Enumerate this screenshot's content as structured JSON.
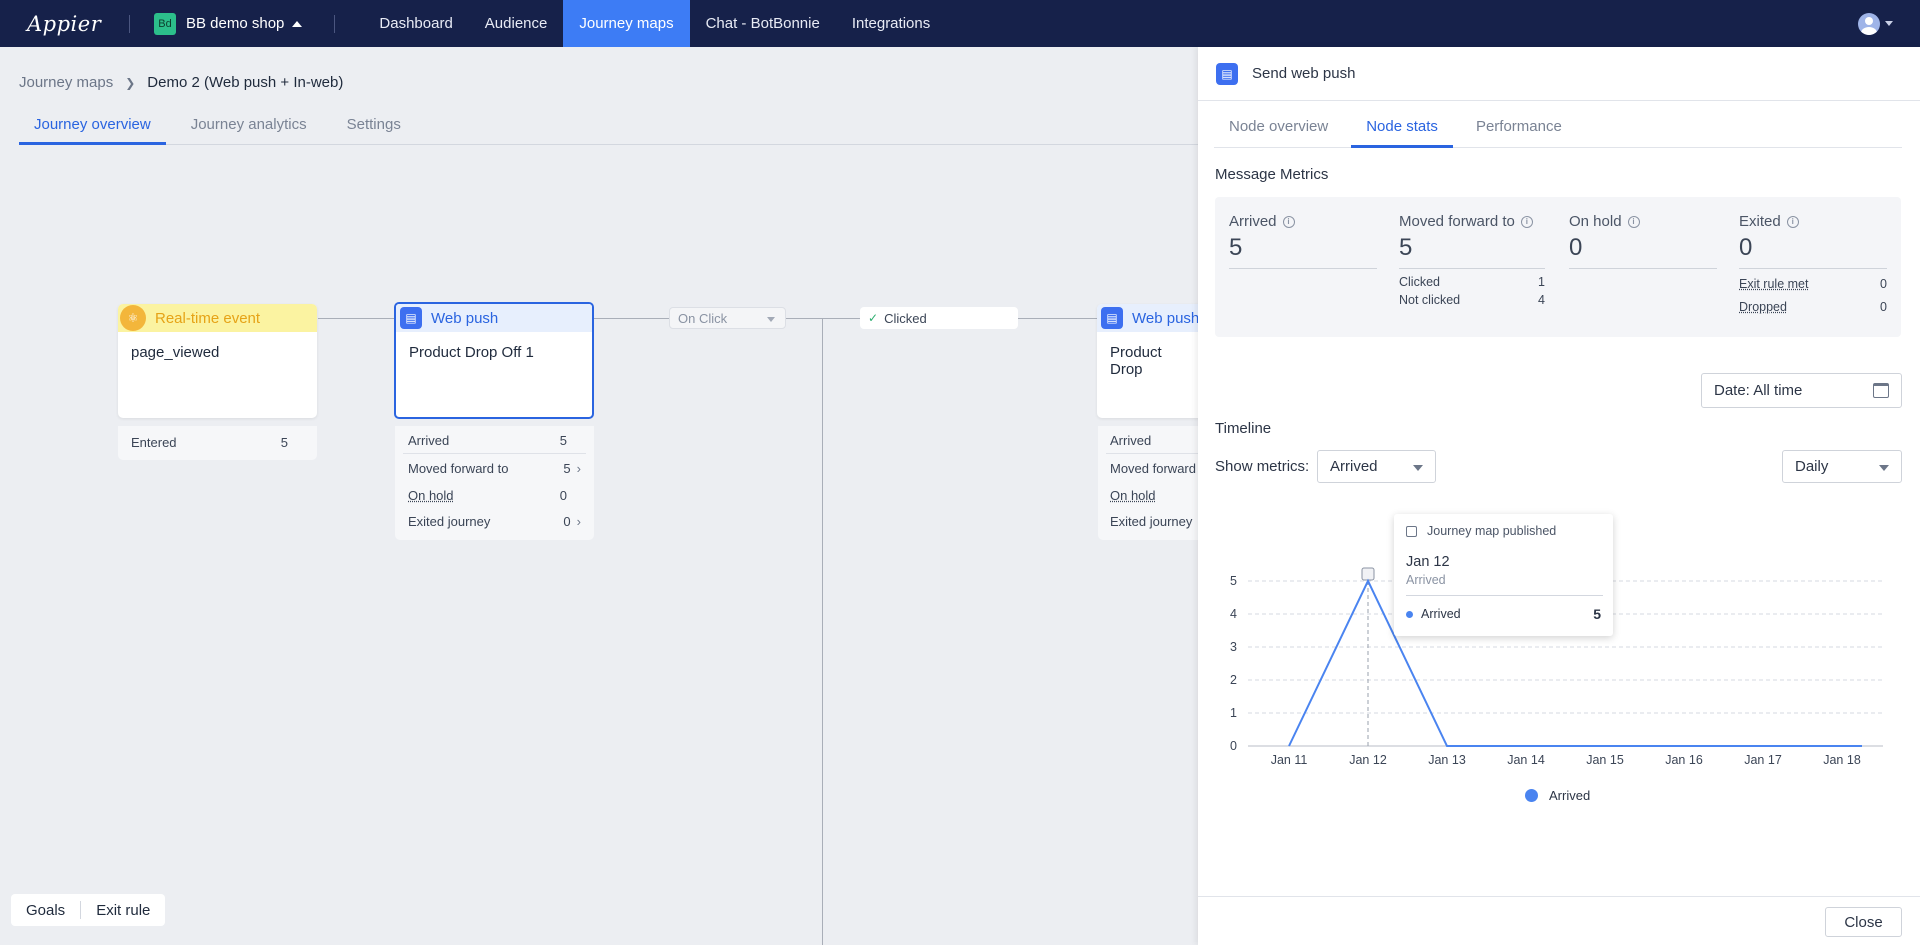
{
  "app": {
    "logo": "Appier"
  },
  "shop": {
    "badge": "Bd",
    "name": "BB demo shop"
  },
  "nav": {
    "items": [
      "Dashboard",
      "Audience",
      "Journey maps",
      "Chat - BotBonnie",
      "Integrations"
    ],
    "active_index": 2
  },
  "breadcrumb": {
    "parent": "Journey maps",
    "current": "Demo 2 (Web push + In-web)"
  },
  "subtabs": [
    "Journey overview",
    "Journey analytics",
    "Settings"
  ],
  "canvas": {
    "event_node": {
      "type": "Real-time event",
      "event": "page_viewed",
      "entered_label": "Entered",
      "entered_value": "5"
    },
    "push_node": {
      "type": "Web push",
      "name": "Product Drop Off 1",
      "stats": [
        {
          "label": "Arrived",
          "value": "5"
        },
        {
          "label": "Moved forward to",
          "value": "5"
        },
        {
          "label": "On hold",
          "value": "0"
        },
        {
          "label": "Exited journey",
          "value": "0"
        }
      ]
    },
    "on_click_label": "On Click",
    "clicked_label": "Clicked",
    "push_node_2": {
      "type": "Web push",
      "name": "Product Drop",
      "stats": [
        "Arrived",
        "Moved forward",
        "On hold",
        "Exited journey"
      ]
    }
  },
  "bottom_bar": {
    "goals": "Goals",
    "exit_rule": "Exit rule"
  },
  "panel": {
    "title": "Send web push",
    "tabs": [
      "Node overview",
      "Node stats",
      "Performance"
    ],
    "active_tab": 1,
    "metrics_title": "Message Metrics",
    "metrics": {
      "arrived": {
        "label": "Arrived",
        "value": "5"
      },
      "moved": {
        "label": "Moved forward to",
        "value": "5",
        "clicked_label": "Clicked",
        "clicked": "1",
        "not_clicked_label": "Not clicked",
        "not_clicked": "4"
      },
      "on_hold": {
        "label": "On hold",
        "value": "0"
      },
      "exited": {
        "label": "Exited",
        "value": "0",
        "exit_rule_label": "Exit rule met",
        "exit_rule": "0",
        "dropped_label": "Dropped",
        "dropped": "0"
      }
    },
    "date_filter": "Date: All time",
    "timeline_title": "Timeline",
    "show_metrics_label": "Show metrics:",
    "metric_select": "Arrived",
    "granularity_select": "Daily",
    "tooltip": {
      "event": "Journey map published",
      "date": "Jan 12",
      "sub": "Arrived",
      "series": "Arrived",
      "value": "5"
    },
    "close_label": "Close"
  },
  "chart_data": {
    "type": "line",
    "categories": [
      "Jan 11",
      "Jan 12",
      "Jan 13",
      "Jan 14",
      "Jan 15",
      "Jan 16",
      "Jan 17",
      "Jan 18"
    ],
    "series": [
      {
        "name": "Arrived",
        "values": [
          0,
          5,
          0,
          0,
          0,
          0,
          0,
          0
        ]
      }
    ],
    "yticks": [
      0,
      1,
      2,
      3,
      4,
      5
    ],
    "ylim": [
      0,
      5
    ],
    "grid": true,
    "legend": "bottom",
    "color": "#4a84f0"
  }
}
